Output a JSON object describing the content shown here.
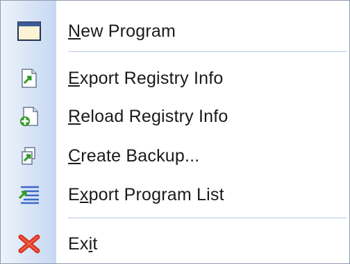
{
  "menu": {
    "items": [
      {
        "label": "New Program",
        "mnemonic_index": 0,
        "icon": "window-icon"
      },
      {
        "label": "Export Registry Info",
        "mnemonic_index": 0,
        "icon": "document-export-icon"
      },
      {
        "label": "Reload Registry Info",
        "mnemonic_index": 0,
        "icon": "document-add-icon"
      },
      {
        "label": "Create Backup...",
        "mnemonic_index": 0,
        "icon": "backup-icon"
      },
      {
        "label": "Export Program List",
        "mnemonic_index": 1,
        "icon": "list-export-icon"
      },
      {
        "label": "Exit",
        "mnemonic_index": 2,
        "icon": "red-x-icon"
      }
    ]
  },
  "colors": {
    "border": "#8e9aae",
    "separator": "#b7c6e0",
    "exit_red": "#d9331f",
    "arrow_green": "#2f9a22"
  }
}
